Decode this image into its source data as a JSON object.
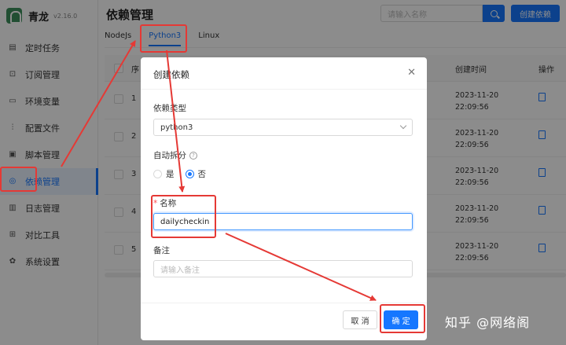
{
  "app": {
    "name": "青龙",
    "version": "v2.16.0"
  },
  "sidebar": {
    "items": [
      {
        "label": "定时任务",
        "icon": "calendar-icon",
        "glyph": "▤"
      },
      {
        "label": "订阅管理",
        "icon": "subscribe-icon",
        "glyph": "⊡"
      },
      {
        "label": "环境变量",
        "icon": "monitor-icon",
        "glyph": "▭"
      },
      {
        "label": "配置文件",
        "icon": "sliders-icon",
        "glyph": "⫶"
      },
      {
        "label": "脚本管理",
        "icon": "script-icon",
        "glyph": "▣"
      },
      {
        "label": "依赖管理",
        "icon": "dependency-icon",
        "glyph": "◎"
      },
      {
        "label": "日志管理",
        "icon": "log-icon",
        "glyph": "▥"
      },
      {
        "label": "对比工具",
        "icon": "diff-icon",
        "glyph": "⊞"
      },
      {
        "label": "系统设置",
        "icon": "settings-icon",
        "glyph": "✿"
      }
    ],
    "active_index": 5
  },
  "header": {
    "title": "依赖管理",
    "search_placeholder": "请输入名称",
    "create_label": "创建依赖"
  },
  "tabs": [
    "NodeJs",
    "Python3",
    "Linux"
  ],
  "active_tab": 1,
  "table": {
    "headers": {
      "index": "序",
      "created": "创建时间",
      "actions": "操作"
    },
    "rows": [
      {
        "index": "1",
        "date": "2023-11-20",
        "time": "22:09:56"
      },
      {
        "index": "2",
        "date": "2023-11-20",
        "time": "22:09:56"
      },
      {
        "index": "3",
        "date": "2023-11-20",
        "time": "22:09:56"
      },
      {
        "index": "4",
        "date": "2023-11-20",
        "time": "22:09:56"
      },
      {
        "index": "5",
        "date": "2023-11-20",
        "time": "22:09:56"
      }
    ]
  },
  "modal": {
    "title": "创建依赖",
    "type_label": "依赖类型",
    "type_value": "python3",
    "auto_split_label": "自动拆分",
    "auto_split_help": "?",
    "radio_yes": "是",
    "radio_no": "否",
    "auto_split_selected": "否",
    "required_mark": "*",
    "name_label": "名称",
    "name_value": "dailycheckin",
    "remark_label": "备注",
    "remark_placeholder": "请输入备注",
    "cancel_label": "取 消",
    "ok_label": "确 定"
  },
  "watermark": "知乎 @网络阁",
  "colors": {
    "primary": "#1677ff",
    "annotation": "#e53935",
    "brand": "#3c8f5b"
  }
}
